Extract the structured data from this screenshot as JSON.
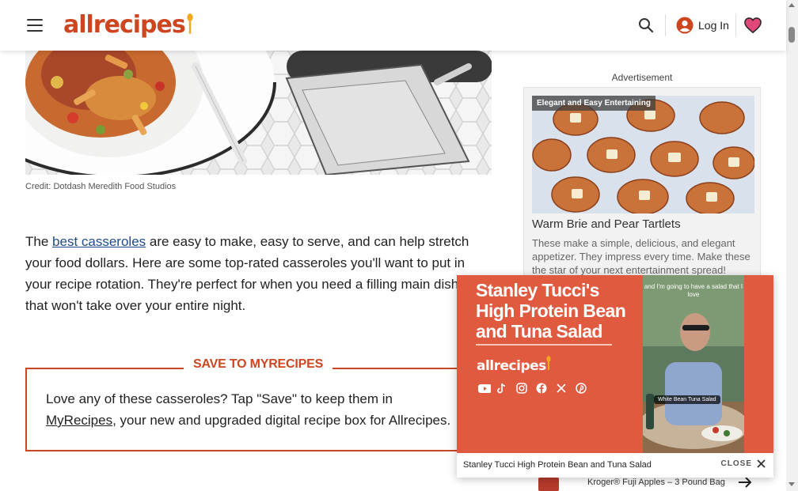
{
  "header": {
    "logo_text": "allrecipes",
    "login_label": "Log In"
  },
  "article": {
    "image_credit": "Credit: Dotdash Meredith Food Studios",
    "intro_before_link": "The ",
    "intro_link": "best casseroles",
    "intro_after_link": " are easy to make, easy to serve, and can help stretch your food dollars. Here are some top-rated casseroles you'll want to put in your recipe rotation. They're perfect for when you need a filling main dish that won't take over your entire night."
  },
  "save_box": {
    "title": "SAVE TO MYRECIPES",
    "text_before_link": "Love any of these casseroles? Tap \"Save\" to keep them in ",
    "link": "MyRecipes",
    "text_after_link": ", your new and upgraded digital recipe box for Allrecipes."
  },
  "ad": {
    "label": "Advertisement",
    "tag": "Elegant and Easy Entertaining",
    "title": "Warm Brie and Pear Tartlets",
    "description": "These make a simple, delicious, and elegant appetizer. They impress every time. Make these the star of your next entertainment spread!"
  },
  "video": {
    "title": "Stanley Tucci's High Protein Bean and Tuna Salad",
    "logo_text": "allrecipes",
    "frame_caption": "and I'm going to have a salad that I love",
    "frame_badge": "White Bean Tuna Salad",
    "footer_title": "Stanley Tucci High Protein Bean and Tuna Salad",
    "close_label": "CLOSE"
  },
  "kroger": {
    "product": "Kroger® Fuji Apples – 3 Pound Bag"
  },
  "colors": {
    "brand": "#ce4620",
    "video_bg": "#e05a3f",
    "link": "#1e4b8a",
    "heart": "#e0487a"
  }
}
